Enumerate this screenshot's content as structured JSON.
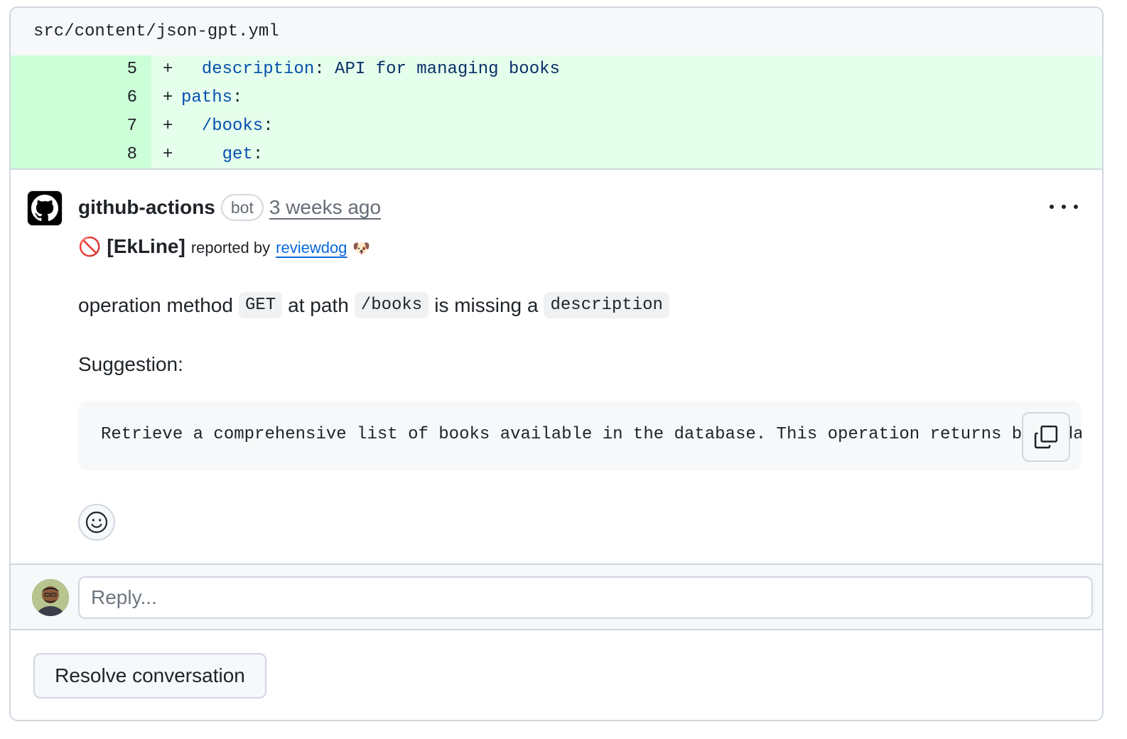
{
  "file": {
    "path": "src/content/json-gpt.yml"
  },
  "diff": {
    "lines": [
      {
        "num": "5",
        "sign": "+",
        "indent": "  ",
        "key": "description",
        "sep": ":",
        "value": " API for managing books"
      },
      {
        "num": "6",
        "sign": "+",
        "indent": "",
        "key": "paths",
        "sep": ":",
        "value": ""
      },
      {
        "num": "7",
        "sign": "+",
        "indent": "  ",
        "key": "/books",
        "sep": ":",
        "value": ""
      },
      {
        "num": "8",
        "sign": "+",
        "indent": "    ",
        "key": "get",
        "sep": ":",
        "value": ""
      }
    ]
  },
  "comment": {
    "author": "github-actions",
    "badge": "bot",
    "time": "3 weeks ago",
    "title_icon": "🚫",
    "title": "[EkLine]",
    "reported_by": "reported by",
    "reporter": "reviewdog",
    "reporter_emoji": "🐶",
    "message": {
      "part1": "operation method",
      "code1": "GET",
      "part2": "at path",
      "code2": "/books",
      "part3": "is missing a",
      "code3": "description"
    },
    "suggestion_label": "Suggestion:",
    "suggestion_code": "Retrieve a comprehensive list of books available in the database. This operation returns book data"
  },
  "reply": {
    "placeholder": "Reply..."
  },
  "actions": {
    "resolve_label": "Resolve conversation"
  },
  "colors": {
    "diff_added_bg": "#e6ffec",
    "diff_added_num_bg": "#ccffd8",
    "link": "#0969da",
    "border": "#d0d7de"
  }
}
